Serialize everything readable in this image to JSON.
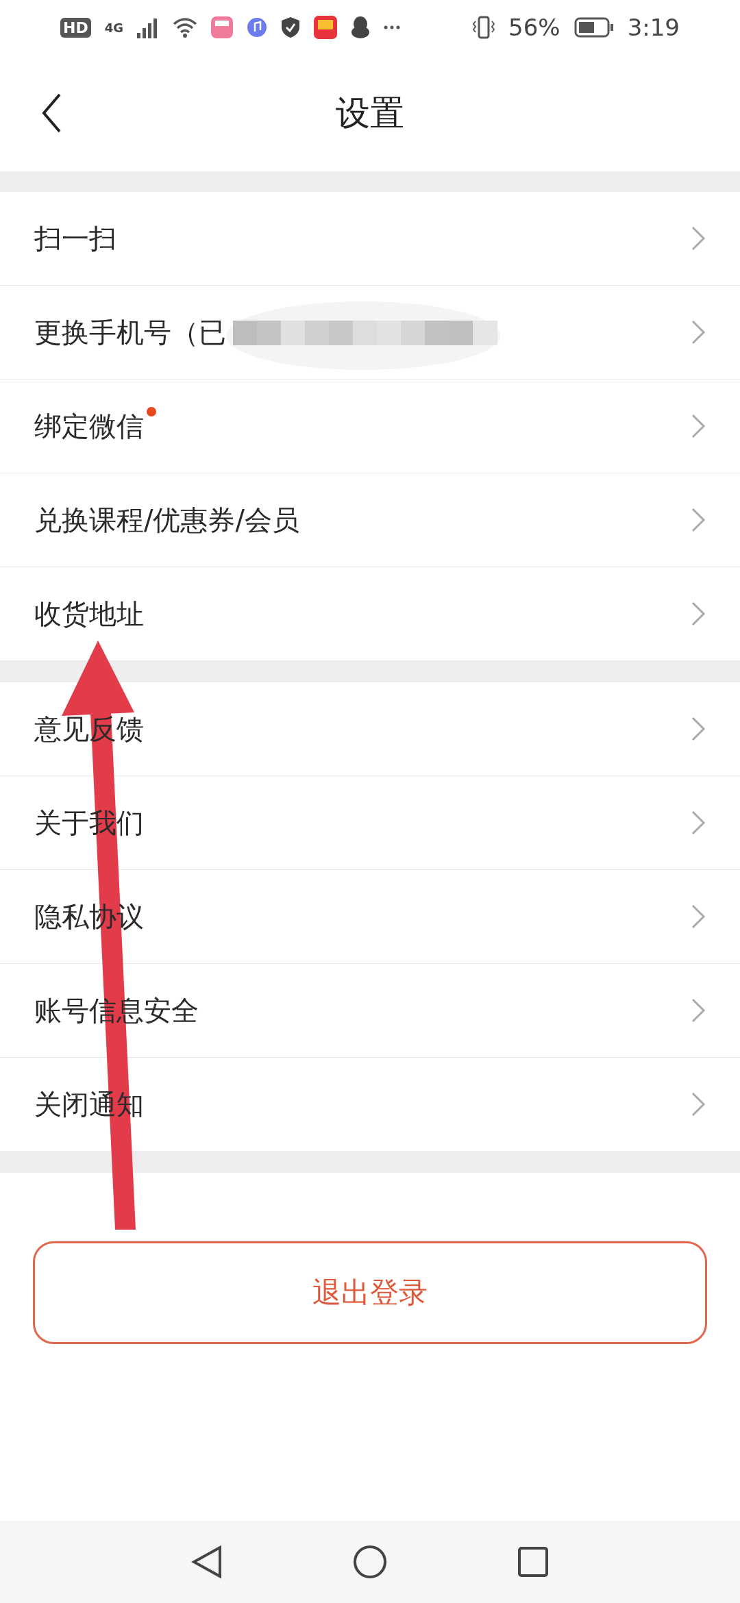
{
  "status_bar": {
    "hd": "HD",
    "network": "4G",
    "battery": "56%",
    "time": "3:19"
  },
  "header": {
    "title": "设置"
  },
  "groups": [
    {
      "items": [
        {
          "label": "扫一扫",
          "unread": false,
          "redacted": false
        },
        {
          "label": "更换手机号（已",
          "unread": false,
          "redacted": true
        },
        {
          "label": "绑定微信",
          "unread": true,
          "redacted": false
        },
        {
          "label": "兑换课程/优惠券/会员",
          "unread": false,
          "redacted": false
        },
        {
          "label": "收货地址",
          "unread": false,
          "redacted": false
        }
      ]
    },
    {
      "items": [
        {
          "label": "意见反馈",
          "unread": false,
          "redacted": false
        },
        {
          "label": "关于我们",
          "unread": false,
          "redacted": false
        },
        {
          "label": "隐私协议",
          "unread": false,
          "redacted": false
        },
        {
          "label": "账号信息安全",
          "unread": false,
          "redacted": false
        },
        {
          "label": "关闭通知",
          "unread": false,
          "redacted": false
        }
      ]
    }
  ],
  "logout_button": "退出登录",
  "annotation": {
    "kind": "arrow"
  }
}
